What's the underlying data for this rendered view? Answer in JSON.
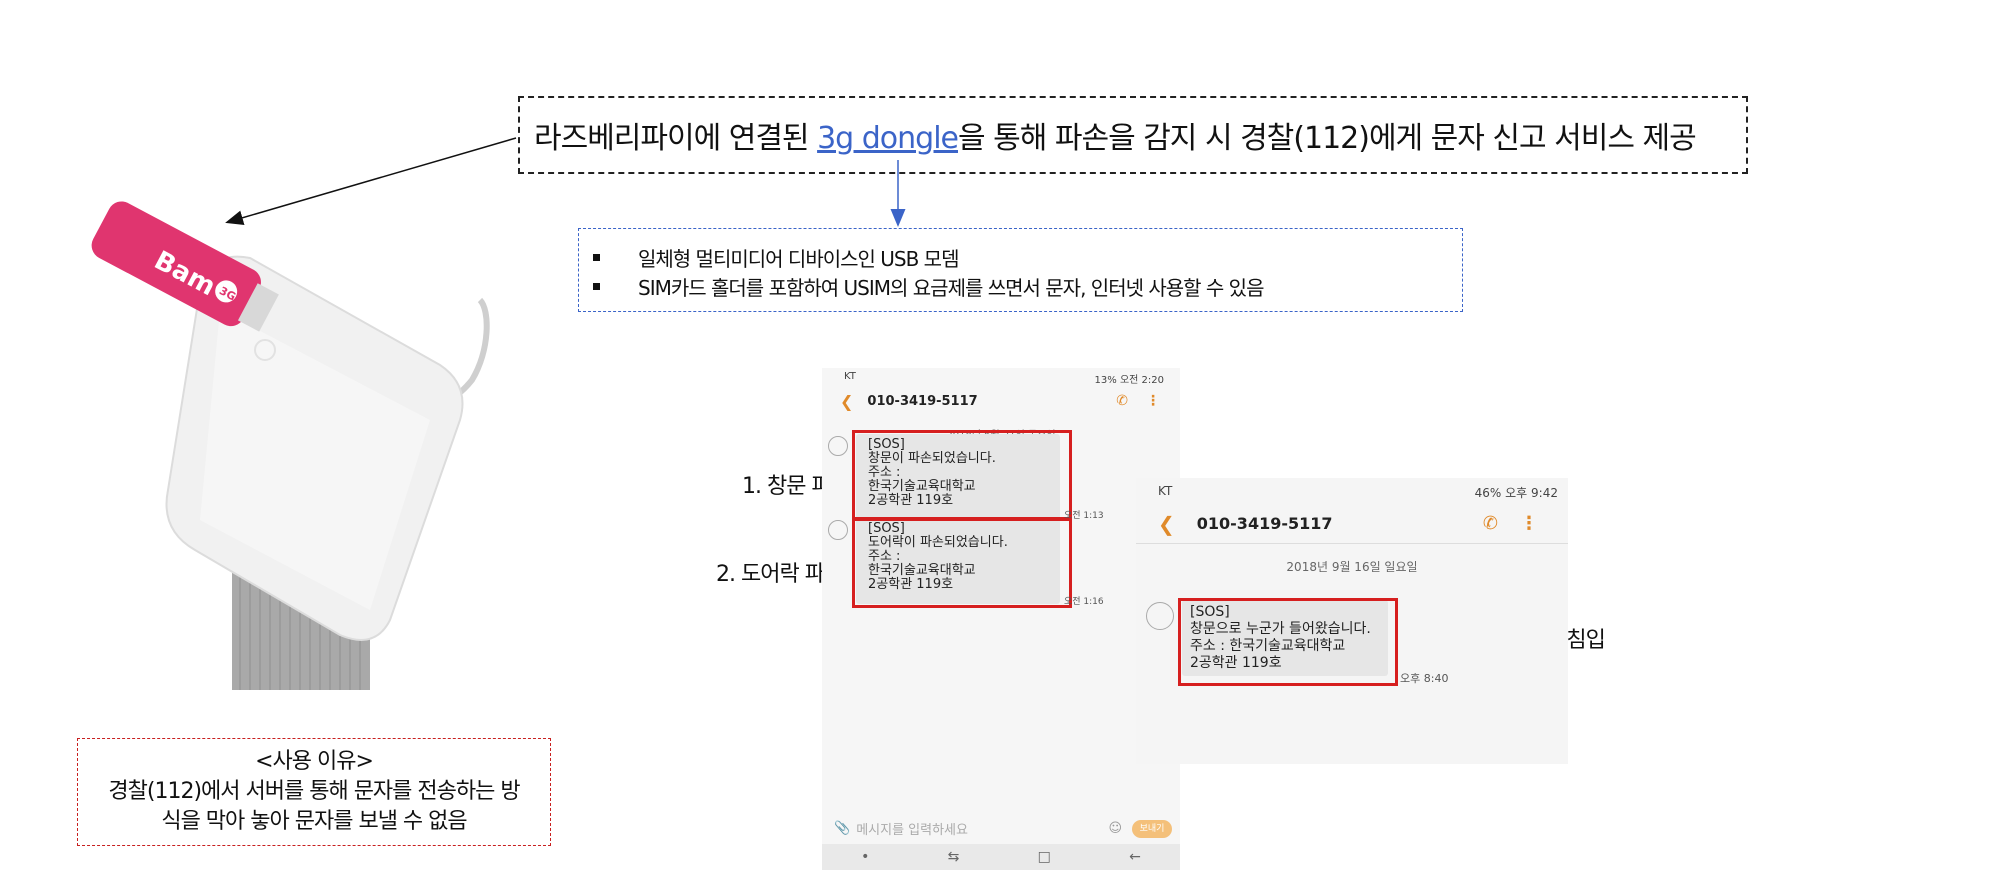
{
  "headline": {
    "before": "라즈베리파이에 연결된 ",
    "link": "3g dongle",
    "after": "을 통해 파손을 감지 시 경찰(112)에게 문자 신고 서비스 제공"
  },
  "info": {
    "items": [
      "일체형 멀티미디어 디바이스인 USB 모뎀",
      "SIM카드 홀더를 포함하여 USIM의  요금제를 쓰면서 문자, 인터넷 사용할 수 있음"
    ]
  },
  "reason": {
    "title": "<사용 이유>",
    "line1": "경찰(112)에서 서버를 통해 문자를 전송하는 방",
    "line2": "식을 막아 놓아 문자를 보낼 수 없음"
  },
  "device": {
    "brand": "Bam"
  },
  "captions": {
    "c1": "1. 창문 파손",
    "c2": "2. 도어락 파손",
    "c3": "3. 창문으로 내부 침입"
  },
  "phone1": {
    "status_left": "KT",
    "status_right": "13% 오전 2:20",
    "contact": "010-3419-5117",
    "date": "2018년 6월 21일 목요일",
    "msg1": {
      "l1": "[SOS]",
      "l2": "창문이 파손되었습니다.",
      "l3": "주소 :",
      "l4": "한국기술교육대학교",
      "l5": "2공학관 119호",
      "time": "오전 1:13"
    },
    "msg2": {
      "l1": "[SOS]",
      "l2": "도어락이 파손되었습니다.",
      "l3": "주소 :",
      "l4": "한국기술교육대학교",
      "l5": "2공학관 119호",
      "time": "오전 1:16"
    },
    "input_placeholder": "메시지를 입력하세요",
    "send": "보내기"
  },
  "phone2": {
    "status_left": "KT",
    "status_right": "46% 오후 9:42",
    "contact": "010-3419-5117",
    "date": "2018년 9월 16일 일요일",
    "msg": {
      "l1": "[SOS]",
      "l2": "창문으로 누군가 들어왔습니다.",
      "l3": "주소 : 한국기술교육대학교",
      "l4": "2공학관 119호",
      "time": "오후 8:40"
    }
  },
  "colors": {
    "accent_blue": "#3b64c8",
    "alert_red": "#d61f1f",
    "phone_orange": "#e08a2a",
    "dongle_pink": "#e0356f"
  }
}
